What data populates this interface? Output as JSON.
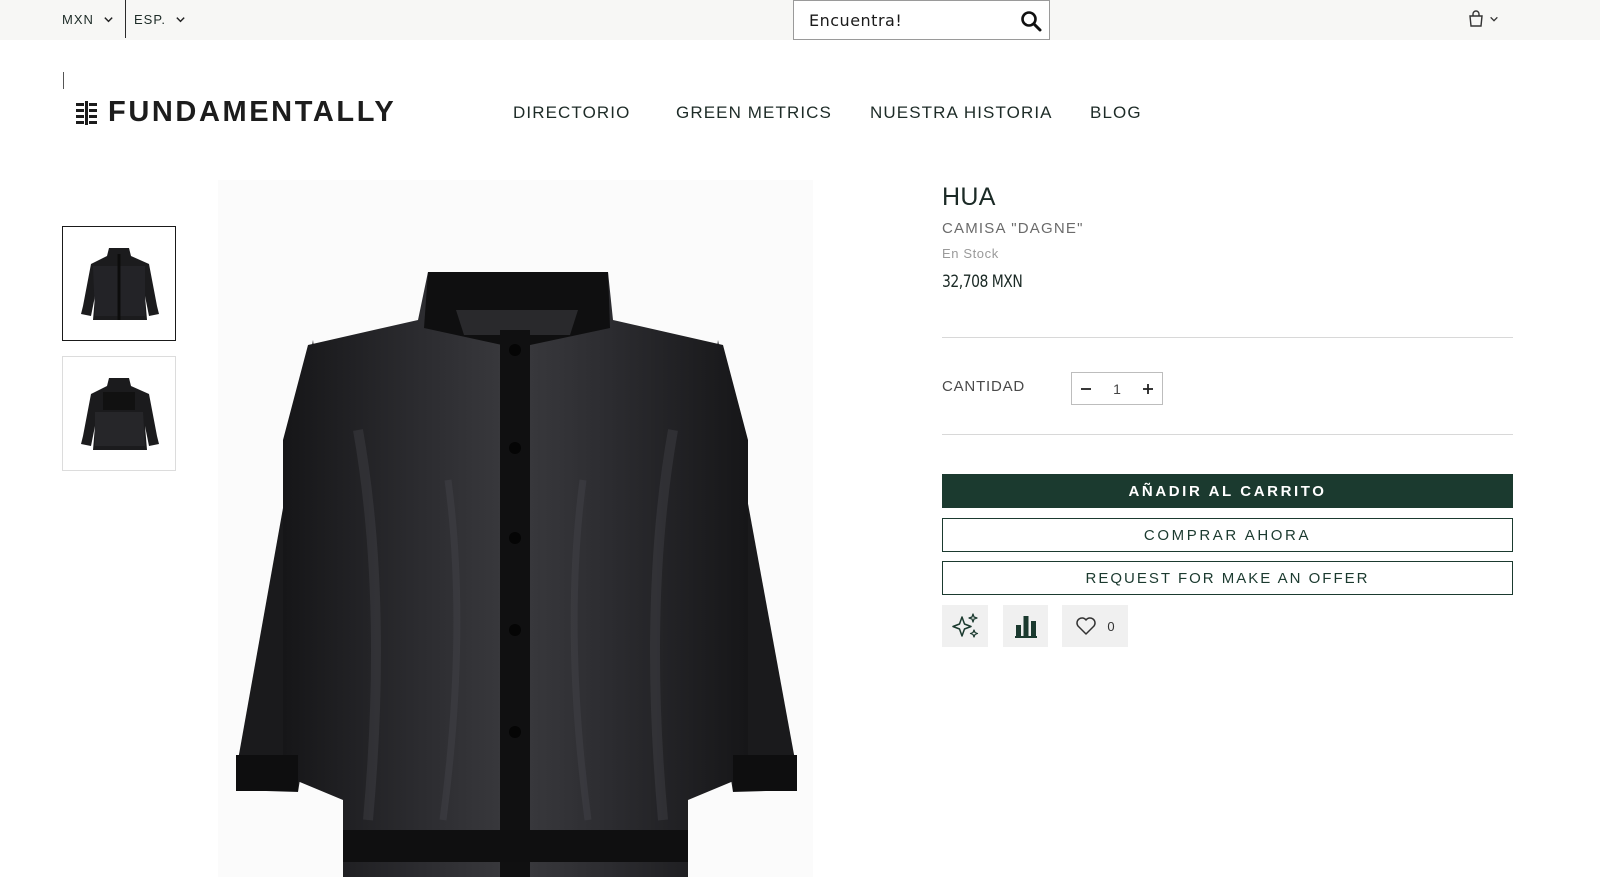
{
  "topbar": {
    "currency": "MXN",
    "language": "ESP.",
    "search_placeholder": "Encuentra!"
  },
  "header": {
    "logo_text": "FUNDAMENTALLY",
    "nav": [
      {
        "label": "DIRECTORIO"
      },
      {
        "label": "GREEN METRICS"
      },
      {
        "label": "NUESTRA HISTORIA"
      },
      {
        "label": "BLOG"
      }
    ]
  },
  "gallery": {
    "thumbnails": [
      {
        "view": "front",
        "selected": true
      },
      {
        "view": "back",
        "selected": false
      }
    ]
  },
  "product": {
    "brand": "HUA",
    "name": "CAMISA \"DAGNE\"",
    "stock": "En Stock",
    "price": "32,708 MXN",
    "quantity_label": "CANTIDAD",
    "quantity": "1",
    "add_to_cart": "AÑADIR AL CARRITO",
    "buy_now": "COMPRAR AHORA",
    "make_offer": "REQUEST FOR MAKE AN OFFER",
    "wishlist_count": "0"
  },
  "colors": {
    "brand_dark_green": "#1b3a2f",
    "topbar_bg": "#f7f7f5",
    "action_bg": "#f0f0f0"
  }
}
